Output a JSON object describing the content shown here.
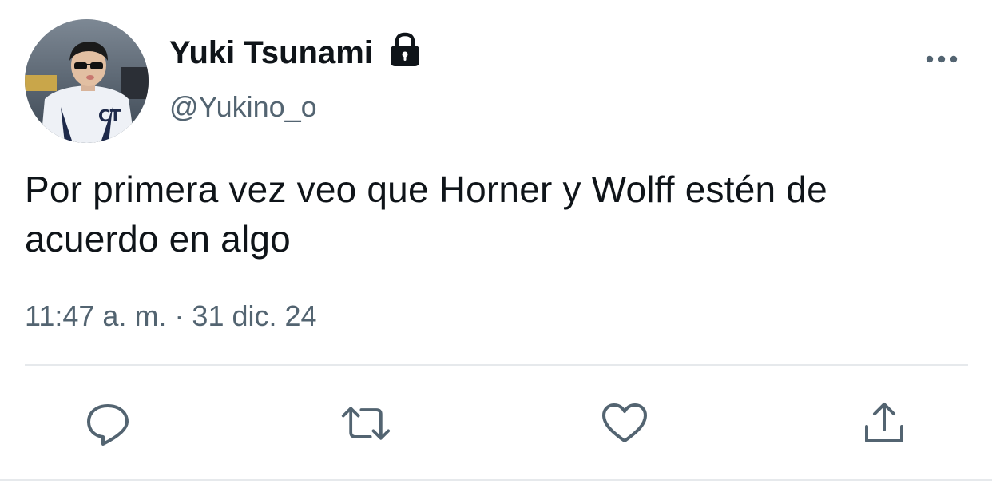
{
  "tweet": {
    "display_name": "Yuki Tsunami",
    "handle": "@Yukino_o",
    "text": "Por primera vez veo que Horner y Wolff estén de acuerdo en algo",
    "timestamp": "11:47 a. m. · 31 dic. 24",
    "protected": true
  },
  "icons": {
    "avatar": "avatar-photo",
    "lock": "lock-icon",
    "more": "more-options-icon",
    "reply": "reply-icon",
    "retweet": "retweet-icon",
    "like": "like-icon",
    "share": "share-icon"
  },
  "colors": {
    "primary_text": "#0f1419",
    "secondary_text": "#536471",
    "divider": "#e6e9ec",
    "background": "#ffffff"
  }
}
